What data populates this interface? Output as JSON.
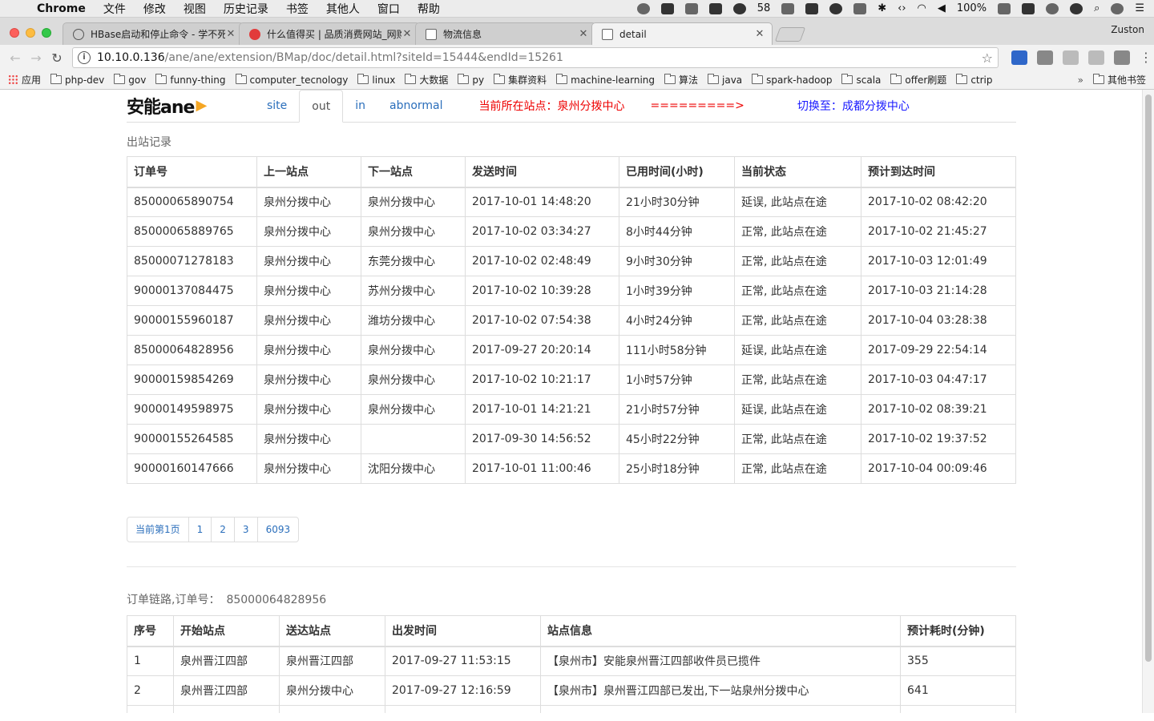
{
  "menubar": {
    "app": "Chrome",
    "items": [
      "文件",
      "修改",
      "视图",
      "历史记录",
      "书签",
      "其他人",
      "窗口",
      "帮助"
    ],
    "tray_count": "58",
    "battery": "100%"
  },
  "tabs": [
    {
      "title": "HBase启动和停止命令 - 学不死",
      "icon": "hbase-icon"
    },
    {
      "title": "什么值得买 | 品质消费网站_网购",
      "icon": "smzdm-icon"
    },
    {
      "title": "物流信息",
      "icon": "doc-icon"
    },
    {
      "title": "detail",
      "icon": "doc-icon",
      "active": true
    }
  ],
  "profile": "Zuston",
  "address": {
    "host": "10.10.0.136",
    "path": "/ane/ane/extension/BMap/doc/detail.html?siteId=15444&endId=15261"
  },
  "bookmarks": [
    "应用",
    "php-dev",
    "gov",
    "funny-thing",
    "computer_tecnology",
    "linux",
    "大数据",
    "py",
    "集群资料",
    "machine-learning",
    "算法",
    "java",
    "spark-hadoop",
    "scala",
    "offer刷题",
    "ctrip"
  ],
  "bookmarks_other": "其他书签",
  "logo": {
    "main": "安能ane",
    "accent": "▶"
  },
  "nav": {
    "tabs": [
      "site",
      "out",
      "in",
      "abnormal"
    ],
    "active": "out",
    "current_station": "当前所在站点：泉州分拨中心",
    "arrow": "=========>",
    "switch_to": "切换至：成都分拨中心"
  },
  "out_section": {
    "title": "出站记录",
    "headers": [
      "订单号",
      "上一站点",
      "下一站点",
      "发送时间",
      "已用时间(小时)",
      "当前状态",
      "预计到达时间"
    ],
    "rows": [
      [
        "85000065890754",
        "泉州分拨中心",
        "泉州分拨中心",
        "2017-10-01 14:48:20",
        "21小时30分钟",
        "延误, 此站点在途",
        "2017-10-02 08:42:20"
      ],
      [
        "85000065889765",
        "泉州分拨中心",
        "泉州分拨中心",
        "2017-10-02 03:34:27",
        "8小时44分钟",
        "正常, 此站点在途",
        "2017-10-02 21:45:27"
      ],
      [
        "85000071278183",
        "泉州分拨中心",
        "东莞分拨中心",
        "2017-10-02 02:48:49",
        "9小时30分钟",
        "正常, 此站点在途",
        "2017-10-03 12:01:49"
      ],
      [
        "90000137084475",
        "泉州分拨中心",
        "苏州分拨中心",
        "2017-10-02 10:39:28",
        "1小时39分钟",
        "正常, 此站点在途",
        "2017-10-03 21:14:28"
      ],
      [
        "90000155960187",
        "泉州分拨中心",
        "潍坊分拨中心",
        "2017-10-02 07:54:38",
        "4小时24分钟",
        "正常, 此站点在途",
        "2017-10-04 03:28:38"
      ],
      [
        "85000064828956",
        "泉州分拨中心",
        "泉州分拨中心",
        "2017-09-27 20:20:14",
        "111小时58分钟",
        "延误, 此站点在途",
        "2017-09-29 22:54:14"
      ],
      [
        "90000159854269",
        "泉州分拨中心",
        "泉州分拨中心",
        "2017-10-02 10:21:17",
        "1小时57分钟",
        "正常, 此站点在途",
        "2017-10-03 04:47:17"
      ],
      [
        "90000149598975",
        "泉州分拨中心",
        "泉州分拨中心",
        "2017-10-01 14:21:21",
        "21小时57分钟",
        "延误, 此站点在途",
        "2017-10-02 08:39:21"
      ],
      [
        "90000155264585",
        "泉州分拨中心",
        "",
        "2017-09-30 14:56:52",
        "45小时22分钟",
        "正常, 此站点在途",
        "2017-10-02 19:37:52"
      ],
      [
        "90000160147666",
        "泉州分拨中心",
        "沈阳分拨中心",
        "2017-10-01 11:00:46",
        "25小时18分钟",
        "正常, 此站点在途",
        "2017-10-04 00:09:46"
      ]
    ]
  },
  "pager": [
    "当前第1页",
    "1",
    "2",
    "3",
    "6093"
  ],
  "chain_section": {
    "title": "订单链路,订单号：",
    "order_no": "85000064828956",
    "headers": [
      "序号",
      "开始站点",
      "送达站点",
      "出发时间",
      "站点信息",
      "预计耗时(分钟)"
    ],
    "rows": [
      [
        "1",
        "泉州晋江四部",
        "泉州晋江四部",
        "2017-09-27 11:53:15",
        "【泉州市】安能泉州晋江四部收件员已揽件",
        "355"
      ],
      [
        "2",
        "泉州晋江四部",
        "泉州分拨中心",
        "2017-09-27 12:16:59",
        "【泉州市】泉州晋江四部已发出,下一站泉州分拨中心",
        "641"
      ],
      [
        "",
        "",
        "",
        "",
        "",
        ""
      ]
    ]
  }
}
